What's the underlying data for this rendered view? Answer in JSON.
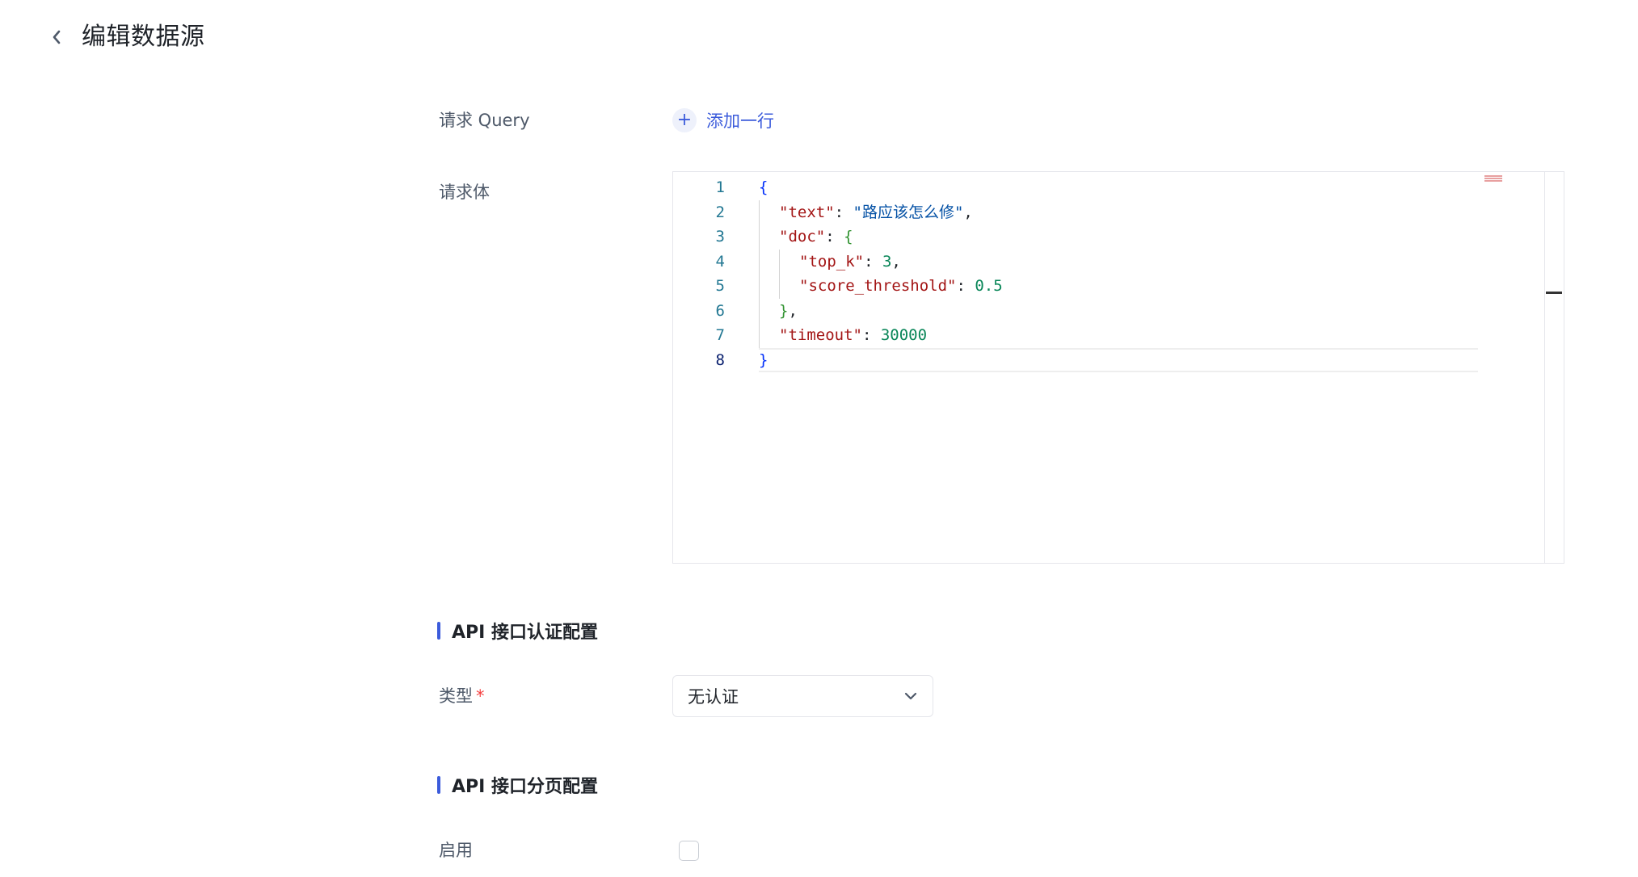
{
  "header": {
    "title": "编辑数据源"
  },
  "request_query": {
    "label": "请求 Query",
    "add_row_label": "添加一行"
  },
  "request_body": {
    "label": "请求体",
    "editor": {
      "active_line": 8,
      "lines": [
        {
          "n": "1",
          "indent": 0,
          "tokens": [
            {
              "t": "{",
              "c": "tok-brace1"
            }
          ]
        },
        {
          "n": "2",
          "indent": 1,
          "tokens": [
            {
              "t": "\"text\"",
              "c": "tok-key"
            },
            {
              "t": ": ",
              "c": "tok-punc"
            },
            {
              "t": "\"路应该怎么修\"",
              "c": "tok-str"
            },
            {
              "t": ",",
              "c": "tok-punc"
            }
          ]
        },
        {
          "n": "3",
          "indent": 1,
          "tokens": [
            {
              "t": "\"doc\"",
              "c": "tok-key"
            },
            {
              "t": ": ",
              "c": "tok-punc"
            },
            {
              "t": "{",
              "c": "tok-brace2"
            }
          ]
        },
        {
          "n": "4",
          "indent": 2,
          "tokens": [
            {
              "t": "\"top_k\"",
              "c": "tok-key"
            },
            {
              "t": ": ",
              "c": "tok-punc"
            },
            {
              "t": "3",
              "c": "tok-num"
            },
            {
              "t": ",",
              "c": "tok-punc"
            }
          ]
        },
        {
          "n": "5",
          "indent": 2,
          "tokens": [
            {
              "t": "\"score_threshold\"",
              "c": "tok-key"
            },
            {
              "t": ": ",
              "c": "tok-punc"
            },
            {
              "t": "0.5",
              "c": "tok-num"
            }
          ]
        },
        {
          "n": "6",
          "indent": 1,
          "tokens": [
            {
              "t": "}",
              "c": "tok-brace2"
            },
            {
              "t": ",",
              "c": "tok-punc"
            }
          ]
        },
        {
          "n": "7",
          "indent": 1,
          "tokens": [
            {
              "t": "\"timeout\"",
              "c": "tok-key"
            },
            {
              "t": ": ",
              "c": "tok-punc"
            },
            {
              "t": "30000",
              "c": "tok-num"
            }
          ]
        },
        {
          "n": "8",
          "indent": 0,
          "tokens": [
            {
              "t": "}",
              "c": "tok-brace1"
            }
          ]
        }
      ]
    }
  },
  "auth_section": {
    "title": "API 接口认证配置",
    "type_label": "类型",
    "required_mark": "*",
    "type_value": "无认证"
  },
  "paging_section": {
    "title": "API 接口分页配置",
    "enable_label": "启用",
    "enabled": false
  },
  "colors": {
    "accent": "#3b5bdb",
    "required": "#f53f3f",
    "label": "#4e5969"
  }
}
